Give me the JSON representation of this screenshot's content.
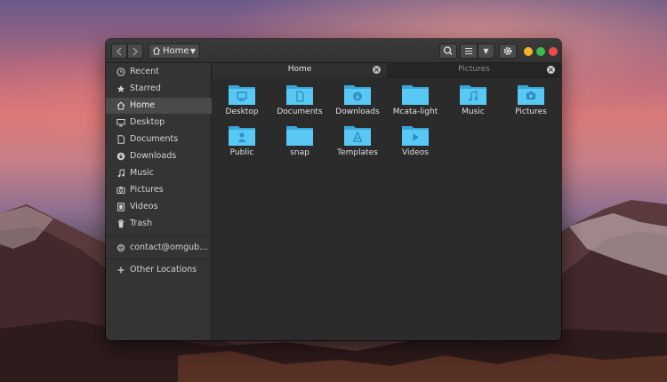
{
  "window": {
    "colors": {
      "folder": "#5ac8f5",
      "folder_dark": "#3aa7d9",
      "accent_close": "#ea4c48",
      "accent_min": "#f6b22c",
      "accent_max": "#3fb951"
    }
  },
  "header": {
    "back_icon": "chevron-left",
    "forward_icon": "chevron-right",
    "path_label": "Home",
    "search_icon": "search",
    "view_icon": "list",
    "menu_icon": "gear"
  },
  "sidebar": {
    "items": [
      {
        "label": "Recent",
        "icon": "clock"
      },
      {
        "label": "Starred",
        "icon": "star"
      },
      {
        "label": "Home",
        "icon": "home",
        "active": true
      },
      {
        "label": "Desktop",
        "icon": "desktop"
      },
      {
        "label": "Documents",
        "icon": "document"
      },
      {
        "label": "Downloads",
        "icon": "download"
      },
      {
        "label": "Music",
        "icon": "music"
      },
      {
        "label": "Pictures",
        "icon": "camera"
      },
      {
        "label": "Videos",
        "icon": "film"
      },
      {
        "label": "Trash",
        "icon": "trash"
      }
    ],
    "account": {
      "label": "contact@omgub…",
      "icon": "network"
    },
    "other_locations": {
      "label": "Other Locations",
      "icon": "plus"
    }
  },
  "tabs": [
    {
      "label": "Home",
      "active": true
    },
    {
      "label": "Pictures",
      "active": false
    }
  ],
  "files": [
    {
      "label": "Desktop",
      "emblem": "desktop"
    },
    {
      "label": "Documents",
      "emblem": "document"
    },
    {
      "label": "Downloads",
      "emblem": "download"
    },
    {
      "label": "Mcata-light",
      "emblem": "none"
    },
    {
      "label": "Music",
      "emblem": "music"
    },
    {
      "label": "Pictures",
      "emblem": "camera"
    },
    {
      "label": "Public",
      "emblem": "person"
    },
    {
      "label": "snap",
      "emblem": "none"
    },
    {
      "label": "Templates",
      "emblem": "template"
    },
    {
      "label": "Videos",
      "emblem": "play"
    }
  ]
}
